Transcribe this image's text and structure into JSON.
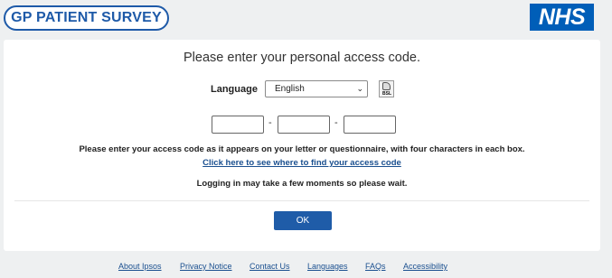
{
  "header": {
    "survey_logo": "GP PATIENT SURVEY",
    "nhs_logo": "NHS"
  },
  "form": {
    "title": "Please enter your personal access code.",
    "language_label": "Language",
    "language_selected": "English",
    "bsl_icon_text": "BSL",
    "code_separator": "-",
    "instructions": "Please enter your access code as it appears on your letter or questionnaire, with four characters in each box.",
    "help_link": "Click here to see where to find your access code",
    "wait_message": "Logging in may take a few moments so please wait.",
    "ok_label": "OK"
  },
  "footer": {
    "links": [
      "About Ipsos",
      "Privacy Notice",
      "Contact Us",
      "Languages",
      "FAQs",
      "Accessibility"
    ]
  },
  "colors": {
    "brand_blue": "#1e5aa8",
    "nhs_blue": "#005eb8",
    "background": "#eef0f1"
  }
}
